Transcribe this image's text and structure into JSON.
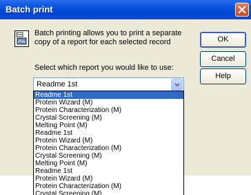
{
  "window": {
    "title": "Batch print"
  },
  "icons": {
    "close": "close-icon",
    "document": "document-icon",
    "dropdown": "chevron-down-icon"
  },
  "dialog": {
    "info_text": "Batch printing allows you to print a separate copy of a report for each selected record",
    "select_label": "Select which report you would like to use:"
  },
  "buttons": {
    "ok": "OK",
    "cancel": "Cancel",
    "help": "Help"
  },
  "combo": {
    "selected": "Readme 1st"
  },
  "dropdown": {
    "options": [
      "Readme 1st",
      "Protein Wizard (M)",
      "Protein Characterization (M)",
      "Crystal Screening (M)",
      "Melting Point (M)",
      "Readme 1st",
      "Protein Wizard (M)",
      "Protein Characterization (M)",
      "Crystal Screening (M)",
      "Melting Point (M)",
      "Readme 1st",
      "Protein Wizard (M)",
      "Protein Characterization (M)",
      "Crystal Screening (M)"
    ],
    "selected_index": 0
  },
  "colors": {
    "titlebar": "#0046d5",
    "selection": "#316ac5",
    "dialog_bg": "#ece9d8"
  }
}
